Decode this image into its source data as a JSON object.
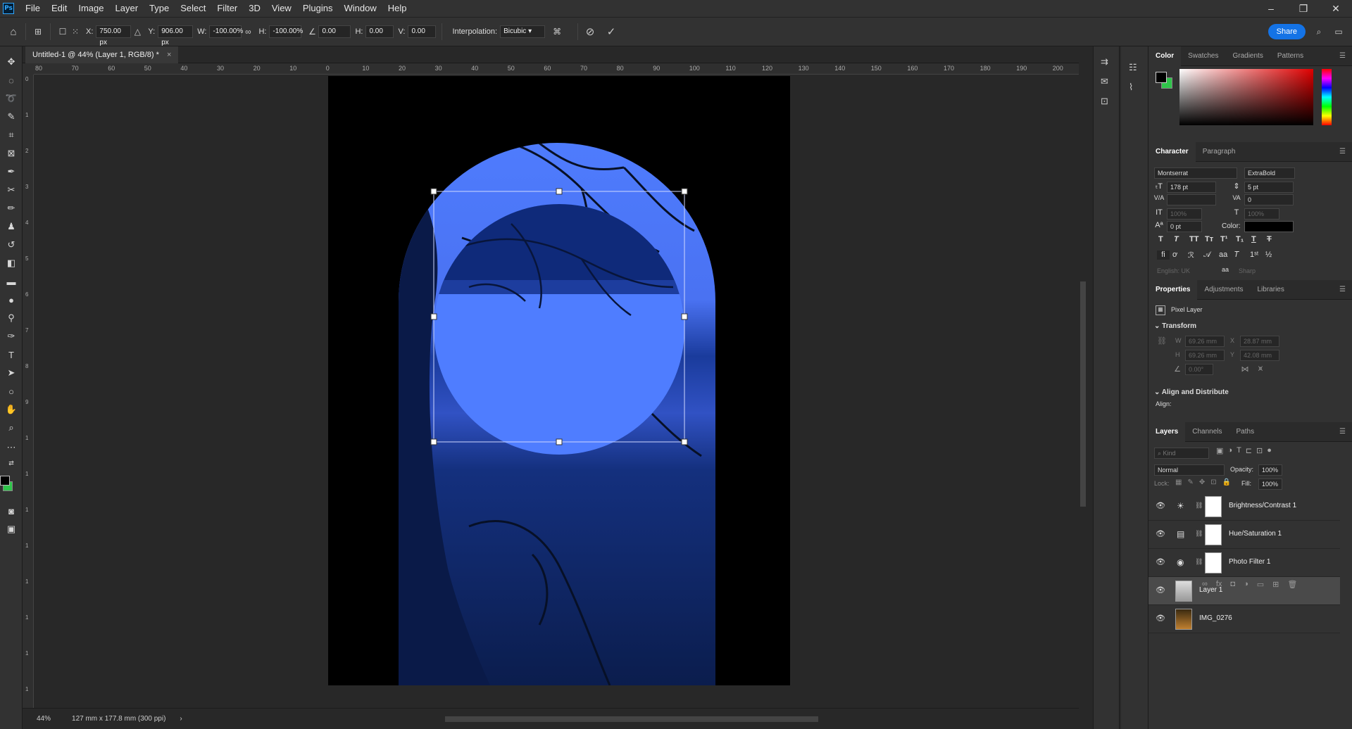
{
  "app": {
    "logo": "Ps"
  },
  "menu": [
    "File",
    "Edit",
    "Image",
    "Layer",
    "Type",
    "Select",
    "Filter",
    "3D",
    "View",
    "Plugins",
    "Window",
    "Help"
  ],
  "window_controls": {
    "minimize": "–",
    "restore": "❐",
    "close": "✕"
  },
  "options": {
    "x_label": "X:",
    "x_value": "750.00 px",
    "y_label": "Y:",
    "y_value": "906.00 px",
    "w_label": "W:",
    "w_value": "-100.00%",
    "h_label": "H:",
    "h_value": "-100.00%",
    "angle_value": "0.00",
    "hskew_label": "H:",
    "hskew_value": "0.00",
    "vskew_label": "V:",
    "vskew_value": "0.00",
    "interp_label": "Interpolation:",
    "interp_value": "Bicubic",
    "share_label": "Share"
  },
  "document_tab": {
    "title": "Untitled-1 @ 44% (Layer 1, RGB/8) *",
    "close": "×"
  },
  "ruler_top_labels": [
    "80",
    "70",
    "60",
    "50",
    "40",
    "30",
    "20",
    "10",
    "0",
    "10",
    "20",
    "30",
    "40",
    "50",
    "60",
    "70",
    "80",
    "90",
    "100",
    "110",
    "120",
    "130",
    "140",
    "150",
    "160",
    "170",
    "180",
    "190",
    "200"
  ],
  "ruler_left_labels": [
    "0",
    "1",
    "2",
    "3",
    "4",
    "5",
    "6",
    "7",
    "8",
    "9",
    "1",
    "1",
    "1",
    "1",
    "1",
    "1",
    "1",
    "1"
  ],
  "status": {
    "zoom": "44%",
    "doc_size": "127 mm x 177.8 mm (300 ppi)"
  },
  "color_panel": {
    "tabs": [
      "Color",
      "Swatches",
      "Gradients",
      "Patterns"
    ],
    "fg": "#000000",
    "bg": "#2fc44a"
  },
  "character_panel": {
    "tabs": [
      "Character",
      "Paragraph"
    ],
    "font_family": "Montserrat",
    "font_style": "ExtraBold",
    "size": "178 pt",
    "leading": "5 pt",
    "tracking": "0",
    "vscale": "100%",
    "hscale": "100%",
    "baseline": "0 pt",
    "color_label": "Color:",
    "language": "English: UK",
    "aa_label": "aa",
    "antialias": "Sharp"
  },
  "properties_panel": {
    "tabs": [
      "Properties",
      "Adjustments",
      "Libraries"
    ],
    "layer_type": "Pixel Layer",
    "transform_label": "Transform",
    "w_label": "W",
    "w_value": "69.26 mm",
    "x_label": "X",
    "x_value": "28.87 mm",
    "h_label": "H",
    "h_value": "69.26 mm",
    "y_label": "Y",
    "y_value": "42.08 mm",
    "angle_value": "0.00°",
    "align_label": "Align and Distribute",
    "align_sub": "Align:"
  },
  "layers_panel": {
    "tabs": [
      "Layers",
      "Channels",
      "Paths"
    ],
    "filter_placeholder": "Kind",
    "blend_mode": "Normal",
    "opacity_label": "Opacity:",
    "opacity_value": "100%",
    "lock_label": "Lock:",
    "fill_label": "Fill:",
    "fill_value": "100%",
    "layers": [
      {
        "name": "Brightness/Contrast 1",
        "type": "adjustment",
        "icon": "☀"
      },
      {
        "name": "Hue/Saturation 1",
        "type": "adjustment",
        "icon": "▤"
      },
      {
        "name": "Photo Filter 1",
        "type": "adjustment",
        "icon": "◉"
      },
      {
        "name": "Layer 1",
        "type": "pixel",
        "selected": true
      },
      {
        "name": "IMG_0276",
        "type": "pixel"
      }
    ]
  }
}
